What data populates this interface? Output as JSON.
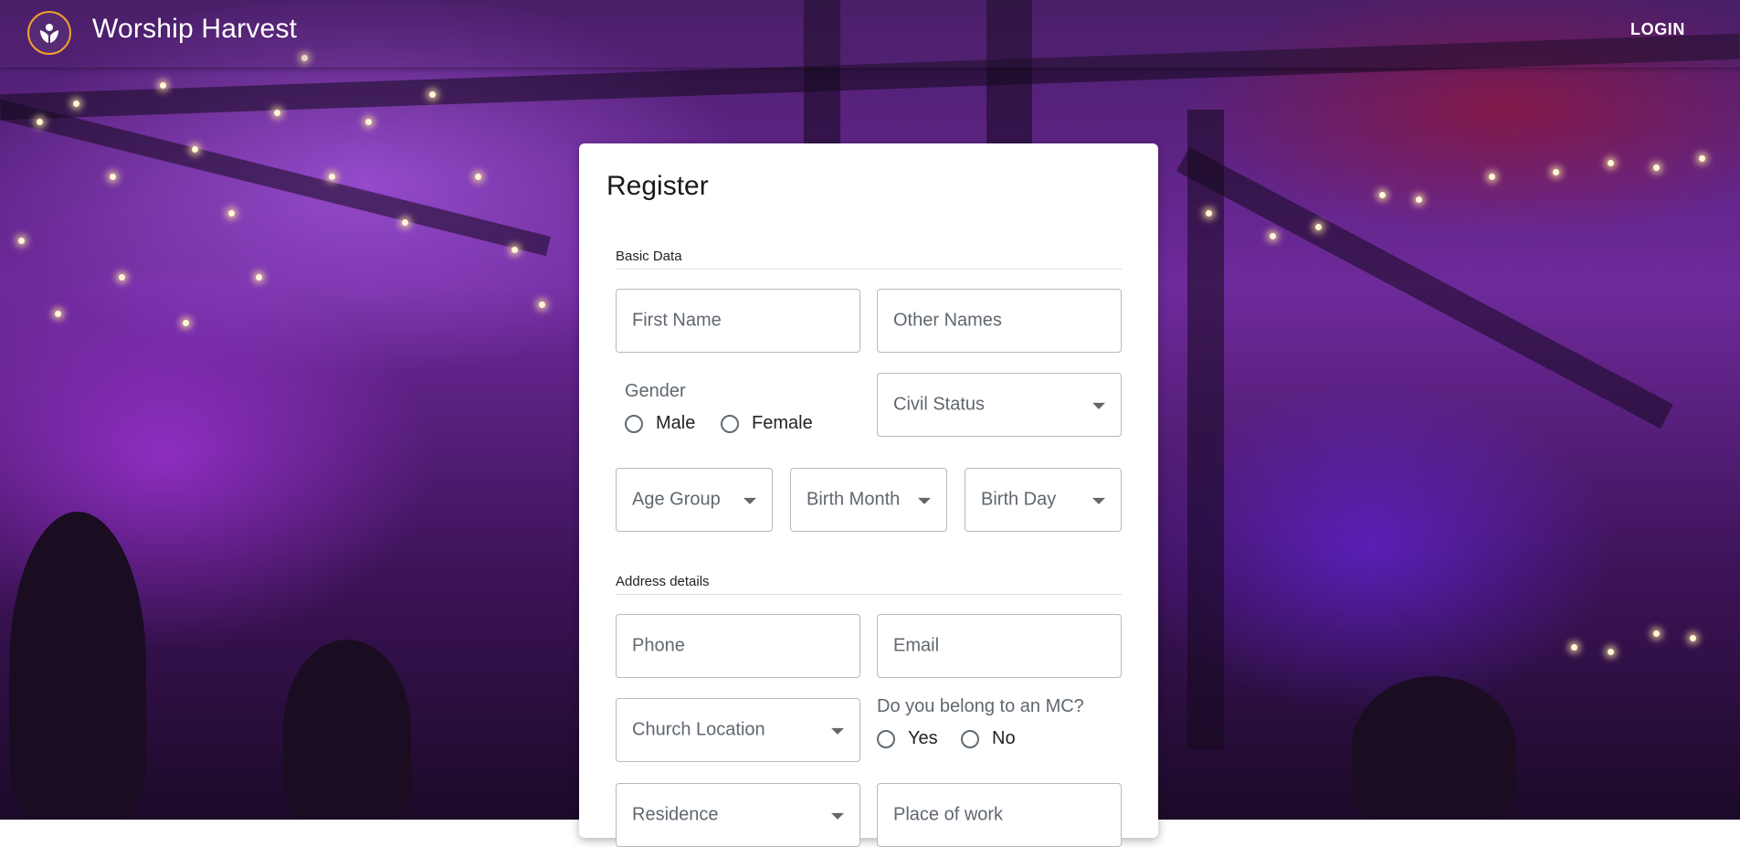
{
  "app": {
    "title": "Worship Harvest",
    "login_label": "LOGIN",
    "logo_icon": "hands-heart-logo-icon"
  },
  "colors": {
    "logo_ring": "#f0a030",
    "card_bg": "#ffffff",
    "field_border": "#b8b8b8",
    "label_text": "#606770"
  },
  "form": {
    "title": "Register",
    "sections": {
      "basic": "Basic Data",
      "address": "Address details"
    },
    "fields": {
      "first_name": "First Name",
      "other_names": "Other Names",
      "civil_status": "Civil Status",
      "age_group": "Age Group",
      "birth_month": "Birth Month",
      "birth_day": "Birth Day",
      "phone": "Phone",
      "email": "Email",
      "church_location": "Church Location",
      "residence": "Residence",
      "place_of_work": "Place of work"
    },
    "gender": {
      "label": "Gender",
      "options": [
        "Male",
        "Female"
      ]
    },
    "mc": {
      "label": "Do you belong to an MC?",
      "options": [
        "Yes",
        "No"
      ]
    }
  }
}
